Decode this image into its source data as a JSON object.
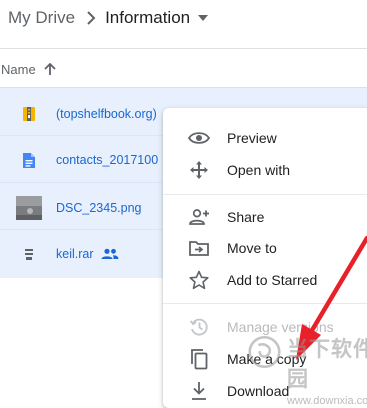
{
  "breadcrumb": {
    "root": "My Drive",
    "current": "Information"
  },
  "list_header": {
    "name_label": "Name"
  },
  "files": [
    {
      "name": "(topshelfbook.org)",
      "icon": "archive-icon"
    },
    {
      "name": "contacts_2017100",
      "icon": "document-icon"
    },
    {
      "name": "DSC_2345.png",
      "icon": "image-thumbnail"
    },
    {
      "name": "keil.rar",
      "icon": "archive-icon",
      "shared": true
    }
  ],
  "context_menu": {
    "items": [
      {
        "label": "Preview",
        "icon": "eye-icon",
        "enabled": true
      },
      {
        "label": "Open with",
        "icon": "move-arrows-icon",
        "enabled": true
      },
      {
        "label": "Share",
        "icon": "add-person-icon",
        "enabled": true
      },
      {
        "label": "Move to",
        "icon": "move-to-folder-icon",
        "enabled": true
      },
      {
        "label": "Add to Starred",
        "icon": "star-icon",
        "enabled": true
      },
      {
        "label": "Manage versions",
        "icon": "history-icon",
        "enabled": false
      },
      {
        "label": "Make a copy",
        "icon": "copy-icon",
        "enabled": true
      },
      {
        "label": "Download",
        "icon": "download-icon",
        "enabled": true
      }
    ]
  },
  "watermark": {
    "title": "当下软件园",
    "url": "www.downxia.com"
  },
  "colors": {
    "selection": "#e8f0fe",
    "link_blue": "#1967d2",
    "annotation_red": "#e8202a"
  }
}
